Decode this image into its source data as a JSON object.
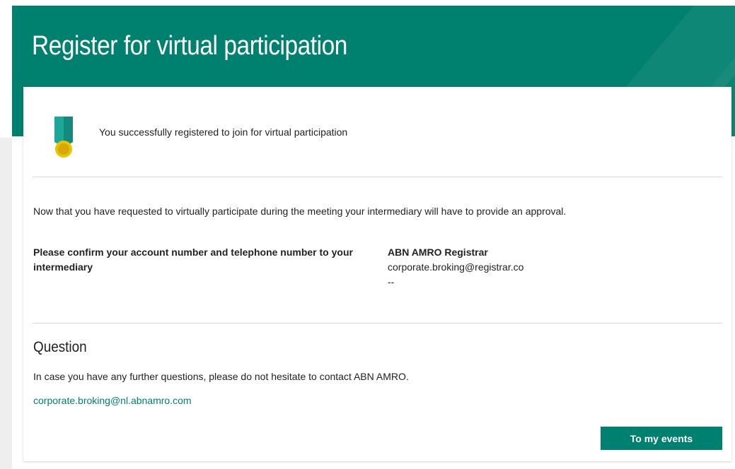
{
  "banner": {
    "title": "Register for virtual participation"
  },
  "success": {
    "icon": "medal-icon",
    "message": "You successfully registered to join for virtual participation"
  },
  "intro": {
    "text": "Now that you have requested to virtually participate during the meeting your intermediary will have to provide an approval."
  },
  "confirm": {
    "label": "Please confirm your account number and telephone number to your intermediary"
  },
  "registrar": {
    "name": "ABN AMRO Registrar",
    "email": "corporate.broking@registrar.co",
    "phone": "--"
  },
  "question": {
    "heading": "Question",
    "text": "In case you have any further questions, please do not hesitate to contact ABN AMRO.",
    "contact_email": "corporate.broking@nl.abnamro.com"
  },
  "actions": {
    "events_label": "To my events"
  },
  "colors": {
    "brand": "#00806e",
    "medal_ribbon": "#1aa89a",
    "medal_gold": "#e0b400"
  }
}
